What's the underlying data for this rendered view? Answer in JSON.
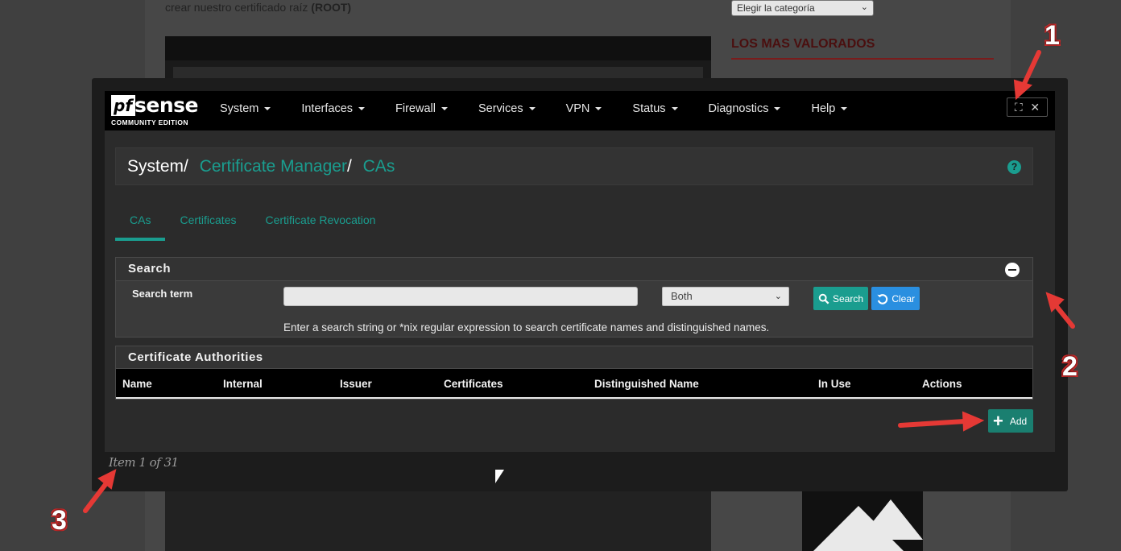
{
  "blog": {
    "text_line": "crear nuestro certificado raíz",
    "text_bold": "(ROOT)",
    "category_select": "Elegir la categoría",
    "sidebar_heading": "LOS MAS VALORADOS"
  },
  "pfsense": {
    "logo_pf": "pf",
    "logo_sense": "sense",
    "logo_sub": "COMMUNITY EDITION",
    "nav": [
      "System",
      "Interfaces",
      "Firewall",
      "Services",
      "VPN",
      "Status",
      "Diagnostics",
      "Help"
    ],
    "breadcrumb": {
      "root": "System",
      "level1": "Certificate Manager",
      "level2": "CAs"
    },
    "tabs": [
      {
        "label": "CAs",
        "active": true
      },
      {
        "label": "Certificates",
        "active": false
      },
      {
        "label": "Certificate Revocation",
        "active": false
      }
    ],
    "search_panel": {
      "title": "Search",
      "term_label": "Search term",
      "term_value": "",
      "scope_selected": "Both",
      "search_button": "Search",
      "clear_button": "Clear",
      "help_text": "Enter a search string or *nix regular expression to search certificate names and distinguished names."
    },
    "ca_panel": {
      "title": "Certificate Authorities",
      "columns": [
        "Name",
        "Internal",
        "Issuer",
        "Certificates",
        "Distinguished Name",
        "In Use",
        "Actions"
      ]
    },
    "add_button": "Add"
  },
  "lightbox": {
    "counter": "Item 1 of 31"
  },
  "annotations": [
    "1",
    "2",
    "3"
  ],
  "colors": {
    "accent": "#1a9d8f",
    "clear_button": "#2a8fe0",
    "arrow": "#e53935"
  }
}
